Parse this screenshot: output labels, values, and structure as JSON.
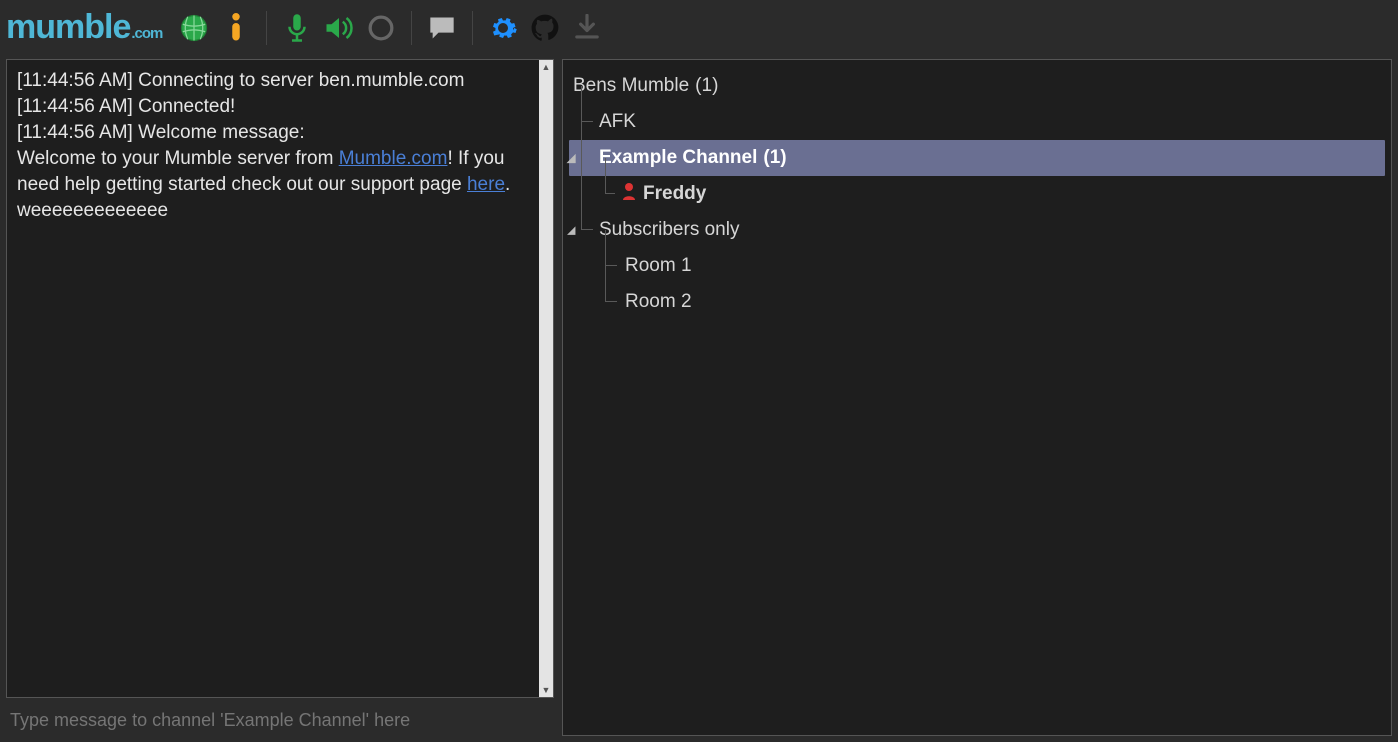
{
  "app": {
    "logo_main": "mumble",
    "logo_suffix": ".com"
  },
  "toolbar_icons": {
    "globe": "globe-icon",
    "info": "info-icon",
    "mic": "microphone-icon",
    "speaker": "speaker-icon",
    "record": "record-icon",
    "chat": "chat-icon",
    "settings": "gear-icon",
    "github": "github-icon",
    "download": "download-icon"
  },
  "log": {
    "line1_time": "[11:44:56 AM] ",
    "line1_text": "Connecting to server ben.mumble.com",
    "line2_time": "[11:44:56 AM] ",
    "line2_text": "Connected!",
    "line3_time": "[11:44:56 AM] ",
    "line3_text": "Welcome message:",
    "welcome_pre": "Welcome to your Mumble server from ",
    "welcome_link1": "Mumble.com",
    "welcome_mid": "! If you need help getting started check out our support page ",
    "welcome_link2": "here",
    "welcome_post": ".       weeeeeeeeeeeee"
  },
  "input": {
    "placeholder": "Type message to channel 'Example Channel' here"
  },
  "tree": {
    "root_name": "Bens Mumble",
    "root_count": "(1)",
    "afk": "AFK",
    "example_name": "Example Channel",
    "example_count": "(1)",
    "user1": "Freddy",
    "subs": "Subscribers only",
    "room1": "Room 1",
    "room2": "Room 2"
  }
}
